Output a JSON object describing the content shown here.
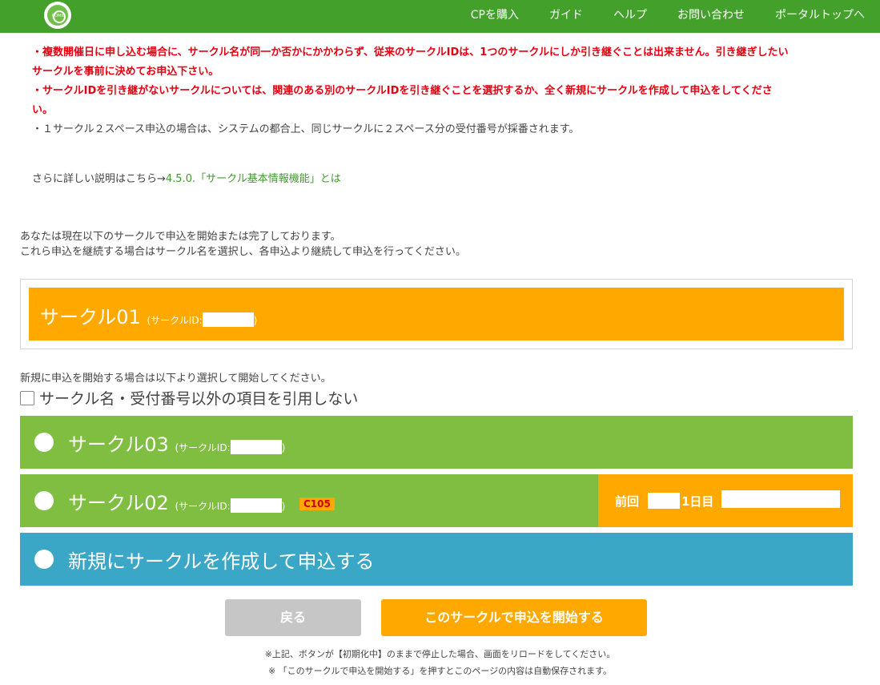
{
  "header": {
    "logo_text": "COMIC",
    "nav": [
      "CPを購入",
      "ガイド",
      "ヘルプ",
      "お問い合わせ",
      "ポータルトップへ"
    ]
  },
  "notes": {
    "red_1a": "・複数開催日に申し込む場合に、サークル名が同一か否かにかかわらず、従来のサークルIDは、1つのサークルにしか引き継ぐことは出来ません。引き継ぎしたい",
    "red_1b": "サークルを事前に決めてお申込下さい。",
    "red_2a": "・サークルIDを引き継がないサークルについては、関連のある別のサークルIDを引き継ぐことを選択するか、全く新規にサークルを作成して申込をしてくださ",
    "red_2b": "い。",
    "gray_1": "・１サークル２スペース申込の場合は、システムの都合上、同じサークルに２スペース分の受付番号が採番されます。"
  },
  "more": {
    "prefix": "さらに詳しい説明はこちら→",
    "link": "4.5.0.「サークル基本情報機能」とは"
  },
  "status": {
    "line1": "あなたは現在以下のサークルで申込を開始または完了しております。",
    "line2": "これら申込を継続する場合はサークル名を選択し、各申込より継続して申込を行ってください。"
  },
  "current_circle": {
    "name": "サークル01",
    "id_prefix": "(サークルID:",
    "id_suffix": ")"
  },
  "new_start": {
    "text": "新規に申込を開始する場合は以下より選択して開始してください。",
    "checkbox_label": "サークル名・受付番号以外の項目を引用しない"
  },
  "options": {
    "circle03": {
      "name": "サークル03",
      "id_prefix": "(サークルID:",
      "id_suffix": ")"
    },
    "circle02": {
      "name": "サークル02",
      "id_prefix": "(サークルID:",
      "id_suffix": ")",
      "badge": "C105",
      "prev_label": "前回",
      "prev_day": "1日目"
    },
    "new_circle": {
      "label": "新規にサークルを作成して申込する"
    }
  },
  "buttons": {
    "back": "戻る",
    "start": "このサークルで申込を開始する"
  },
  "footer_notes": {
    "note1": "※上記、ボタンが【初期化中】のままで停止した場合、画面をリロードをしてください。",
    "note2": "※ 「このサークルで申込を開始する」を押すとこのページの内容は自動保存されます。"
  },
  "colors": {
    "header_green": "#43a12b",
    "orange": "#ffa800",
    "option_green": "#7fbe41",
    "option_blue": "#3aa7c7",
    "warning_red": "#e60012",
    "button_gray": "#c6c6c6"
  }
}
